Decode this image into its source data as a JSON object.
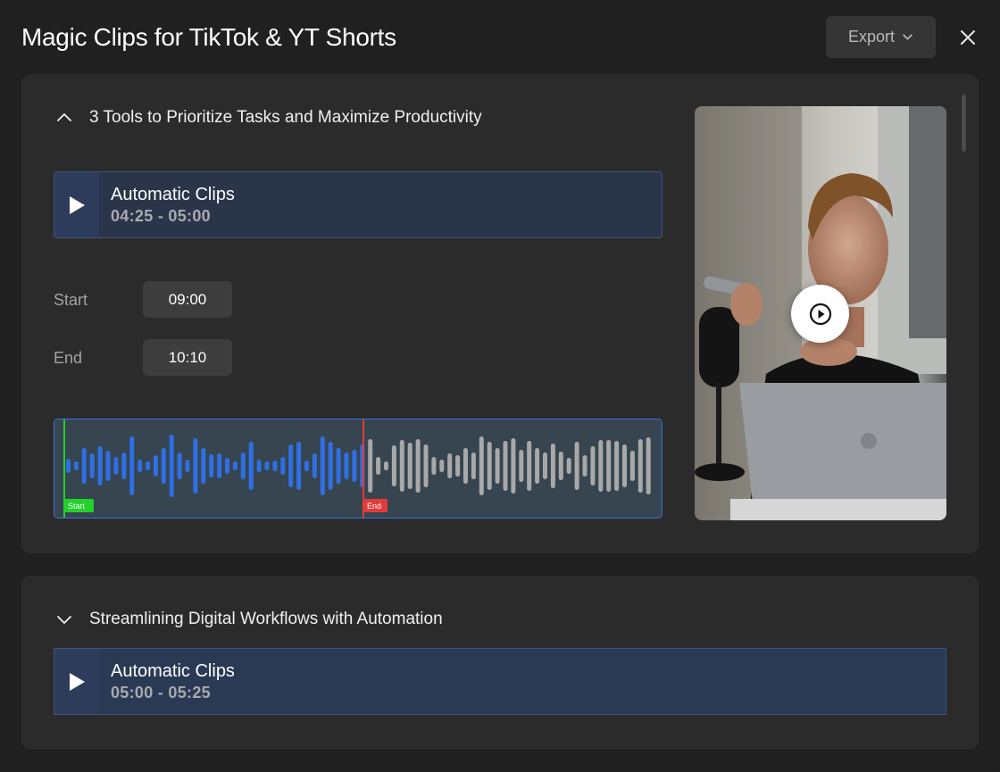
{
  "header": {
    "title": "Magic Clips for TikTok & YT Shorts",
    "export_label": "Export"
  },
  "sections": [
    {
      "title": "3 Tools to Prioritize Tasks and Maximize Productivity",
      "expanded": true,
      "clip": {
        "title": "Automatic Clips",
        "time": "04:25 - 05:00"
      },
      "start_label": "Start",
      "start_value": "09:00",
      "end_label": "End",
      "end_value": "10:10",
      "waveform": {
        "start_marker": "Start",
        "end_marker": "End",
        "selected_color": "#2f6fe4",
        "unselected_color": "#a8a8a8",
        "start_marker_color": "#22d12a",
        "end_marker_color": "#e23b3b"
      }
    },
    {
      "title": "Streamlining Digital Workflows with Automation",
      "expanded": false,
      "clip": {
        "title": "Automatic Clips",
        "time": "05:00 - 05:25"
      }
    }
  ],
  "icons": {
    "export_chevron": "chevron-down-icon",
    "close": "close-icon",
    "collapse": "chevron-up-icon",
    "expand": "chevron-down-icon",
    "play": "play-icon"
  }
}
